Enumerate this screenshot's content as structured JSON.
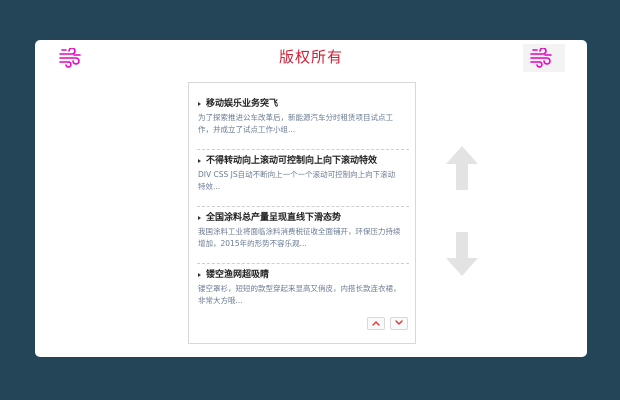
{
  "header": {
    "title": "版权所有",
    "left_icon": "wind-icon",
    "right_icon": "wind-icon",
    "icon_color": "#e800c8",
    "title_color": "#d11f36"
  },
  "news": {
    "items": [
      {
        "title": "移动娱乐业务突飞",
        "desc": "为了探索推进公车改革后，新能源汽车分时租赁项目试点工作，并成立了试点工作小组..."
      },
      {
        "title": "不得转动向上滚动可控制向上向下滚动特效",
        "desc": "DIV CSS JS自动不断向上一个一个滚动可控制向上向下滚动特效..."
      },
      {
        "title": "全国涂料总产量呈现直线下滑态势",
        "desc": "我国涂料工业将面临涂料消费税征收全面铺开，环保压力持续增加，2015年的形势不容乐观..."
      },
      {
        "title": "镂空渔网超吸睛",
        "desc": "镂空罩衫，短短的款型穿起来显高又俏皮，内搭长款连衣裙，非常大方哦..."
      }
    ],
    "mini_up_icon": "chevron-up-icon",
    "mini_down_icon": "chevron-down-icon"
  },
  "controls": {
    "big_up_icon": "arrow-up-icon",
    "big_down_icon": "arrow-down-icon",
    "arrow_color": "#e3e3e3"
  }
}
